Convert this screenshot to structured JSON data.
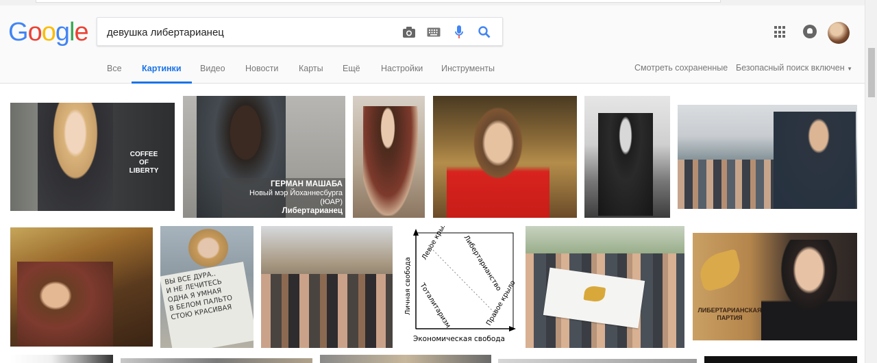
{
  "logo": {
    "letters": [
      "G",
      "o",
      "o",
      "g",
      "l",
      "e"
    ],
    "colors": [
      "#4285f4",
      "#ea4335",
      "#fbbc05",
      "#4285f4",
      "#34a853",
      "#ea4335"
    ]
  },
  "search": {
    "query": "девушка либертарианец"
  },
  "tabs": [
    {
      "label": "Все"
    },
    {
      "label": "Картинки"
    },
    {
      "label": "Видео"
    },
    {
      "label": "Новости"
    },
    {
      "label": "Карты"
    },
    {
      "label": "Ещё"
    },
    {
      "label": "Настройки"
    },
    {
      "label": "Инструменты"
    }
  ],
  "right_links": {
    "saved": "Смотреть сохраненные",
    "safe_search": "Безопасный поиск включен"
  },
  "results": {
    "img1_text": [
      "COFFEE",
      "OF",
      "LIBERTY"
    ],
    "img2_caption": [
      "ГЕРМАН МАШАБА",
      "Новый мэр Йоханнесбурга (ЮАР)",
      "Либертарианец"
    ],
    "img9_sign": [
      "ВЫ ВСЕ ДУРА..",
      "И НЕ ЛЕЧИТЕСЬ",
      "ОДНА Я УМНАЯ",
      "В БЕЛОМ ПАЛЬТО",
      "СТОЮ КРАСИВАЯ"
    ],
    "diagram": {
      "left_wing": "Левое крыло",
      "libertarian": "Либертарианство",
      "totalitarian": "Тоталитаризм",
      "right_wing": "Правое крыло",
      "y_axis": "Личная свобода",
      "x_axis": "Экономическая свобода"
    },
    "img13_text": [
      "ЛИБЕРТАРИАНСКАЯ",
      "ПАРТИЯ"
    ]
  }
}
